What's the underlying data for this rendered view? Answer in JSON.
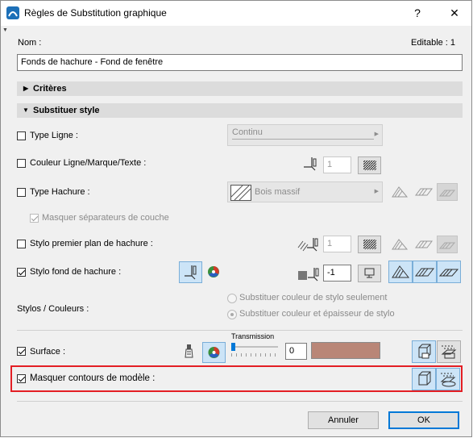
{
  "window": {
    "title": "Règles de Substitution graphique",
    "help_glyph": "?",
    "close_glyph": "✕"
  },
  "name_row": {
    "label": "Nom :",
    "editable_label": "Editable : 1",
    "value": "Fonds de hachure  - Fond de fenêtre"
  },
  "sections": {
    "criteria": "Critères",
    "override_style": "Substituer style"
  },
  "rows": {
    "line_type": {
      "label": "Type Ligne :",
      "checked": false,
      "combo_value": "Continu"
    },
    "line_color": {
      "label": "Couleur Ligne/Marque/Texte :",
      "checked": false,
      "pen_value": "1"
    },
    "fill_type": {
      "label": "Type Hachure :",
      "checked": false,
      "combo_value": "Bois massif"
    },
    "hide_separators": {
      "label": "Masquer séparateurs de couche",
      "checked": true
    },
    "fill_fg_pen": {
      "label": "Stylo premier plan de hachure :",
      "checked": false,
      "pen_value": "1"
    },
    "fill_bg_pen": {
      "label": "Stylo fond de hachure :",
      "checked": true,
      "pen_value": "-1"
    },
    "pens_colors": {
      "label": "Stylos / Couleurs :",
      "option_color_only": "Substituer couleur de stylo seulement",
      "option_color_weight": "Substituer couleur et épaisseur de stylo"
    },
    "surface": {
      "label": "Surface :",
      "checked": true,
      "transmission_label": "Transmission",
      "transmission_value": "0",
      "transmission_fraction": 0.0,
      "swatch_color": "#b98677"
    },
    "hide_model_contours": {
      "label": "Masquer contours de modèle :",
      "checked": true
    }
  },
  "buttons": {
    "cancel": "Annuler",
    "ok": "OK"
  },
  "colors": {
    "accent": "#0078d7",
    "highlight_box": "#e31e24",
    "selected_btn": "#cce4f7"
  }
}
